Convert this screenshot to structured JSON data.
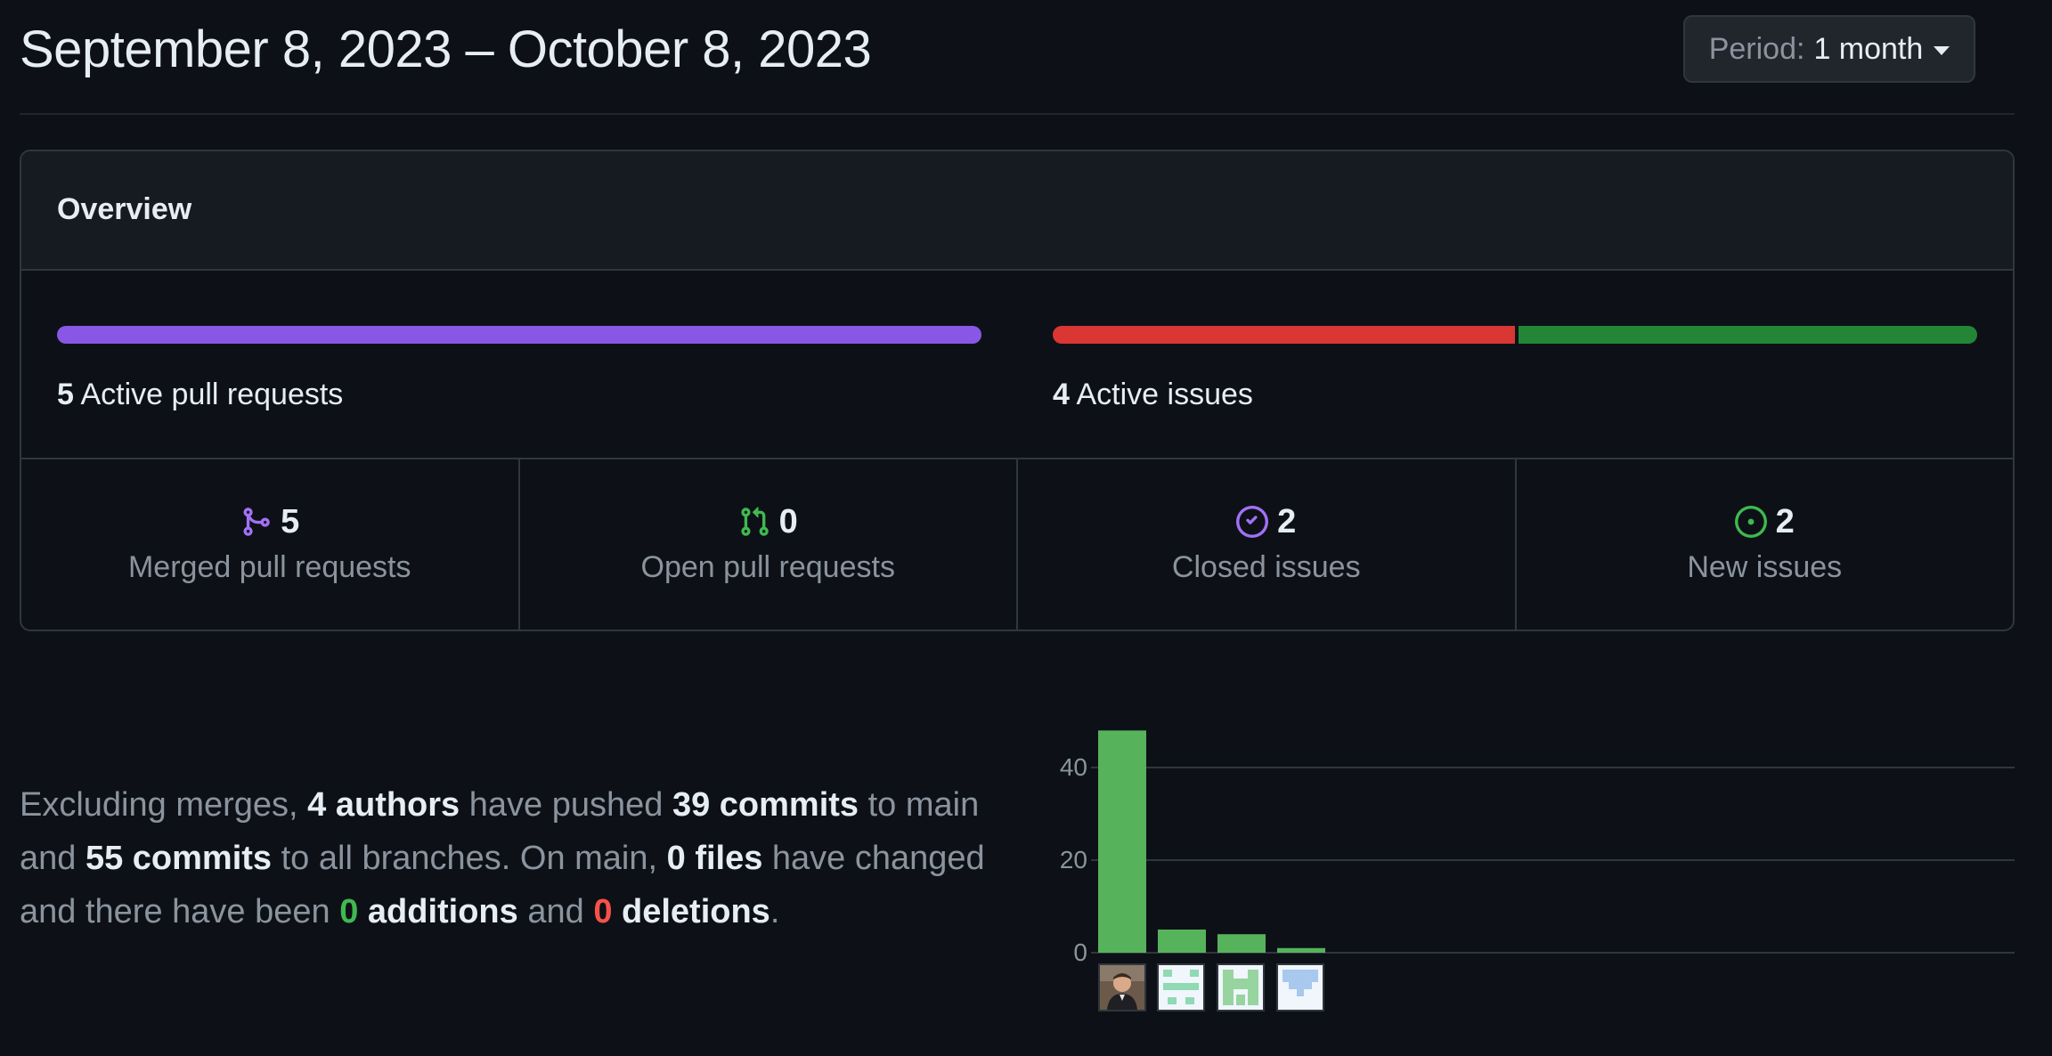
{
  "header": {
    "date_range": "September 8, 2023 – October 8, 2023",
    "period_label": "Period:",
    "period_value": "1 month"
  },
  "overview": {
    "title": "Overview",
    "pull_requests": {
      "count": "5",
      "label": "Active pull requests",
      "bar_color": "#8957e5"
    },
    "issues": {
      "count": "4",
      "label": "Active issues",
      "closed_fraction": 0.5,
      "closed_color": "#da3633",
      "open_color": "#238636"
    },
    "stats": [
      {
        "icon": "git-merge-icon",
        "color": "#a371f7",
        "value": "5",
        "label": "Merged pull requests"
      },
      {
        "icon": "git-pull-request-icon",
        "color": "#3fb950",
        "value": "0",
        "label": "Open pull requests"
      },
      {
        "icon": "issue-closed-icon",
        "color": "#a371f7",
        "value": "2",
        "label": "Closed issues"
      },
      {
        "icon": "issue-opened-icon",
        "color": "#3fb950",
        "value": "2",
        "label": "New issues"
      }
    ]
  },
  "summary": {
    "p1": "Excluding merges, ",
    "authors": "4 authors",
    "p2": " have pushed ",
    "commits_main": "39 commits",
    "p3": " to main and ",
    "commits_all": "55 commits",
    "p4": " to all branches. On main, ",
    "files": "0 files",
    "p5": " have changed and there have been ",
    "additions_num": "0",
    "additions_word": " additions",
    "p6": " and ",
    "deletions_num": "0",
    "deletions_word": " deletions",
    "p7": "."
  },
  "chart_data": {
    "type": "bar",
    "categories": [
      "author-1",
      "author-2",
      "author-3",
      "author-4"
    ],
    "values": [
      48,
      5,
      4,
      1
    ],
    "ylim": [
      0,
      48
    ],
    "yticks": [
      0,
      20,
      40
    ],
    "bar_color": "#56b35b",
    "grid": true
  }
}
